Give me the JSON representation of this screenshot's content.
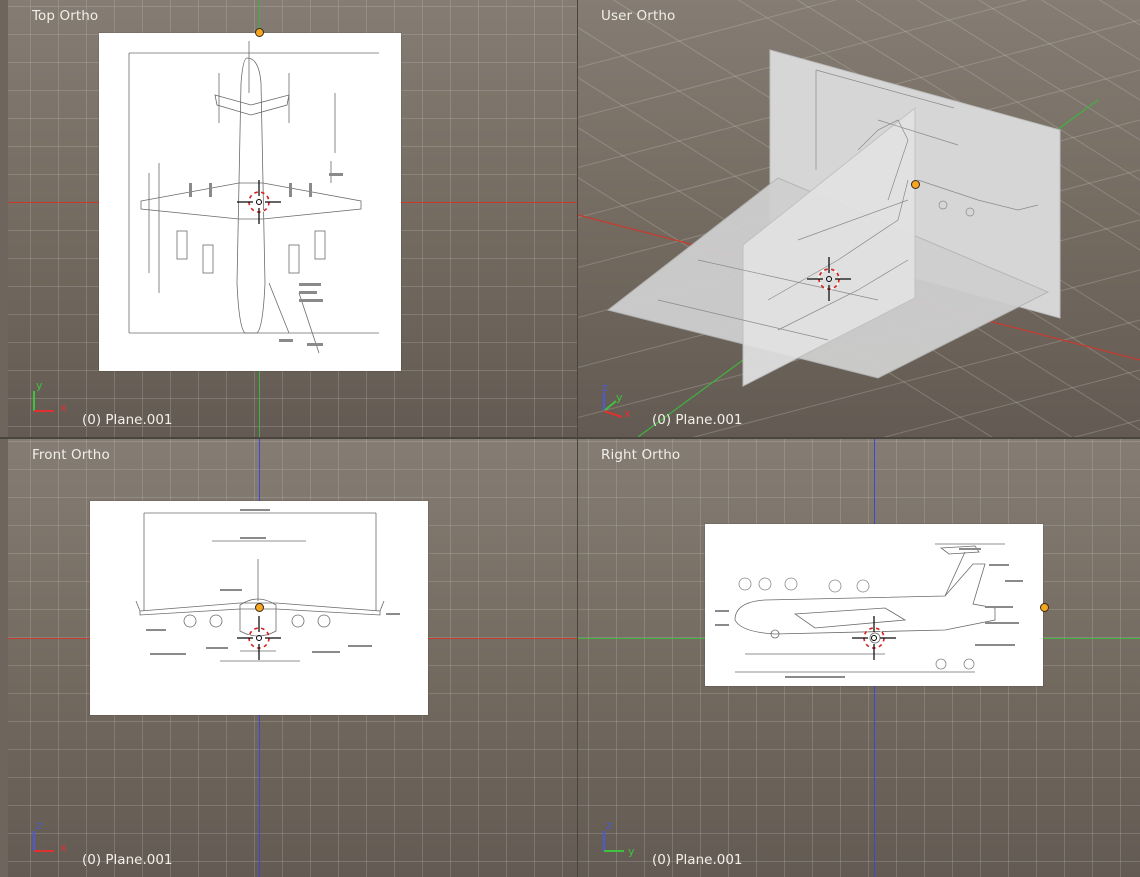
{
  "viewports": {
    "top": {
      "title": "Top Ortho",
      "object": "(0) Plane.001",
      "gizmo": [
        "y",
        "x"
      ]
    },
    "user": {
      "title": "User Ortho",
      "object": "(0) Plane.001",
      "gizmo": [
        "z",
        "y",
        "x"
      ]
    },
    "front": {
      "title": "Front Ortho",
      "object": "(0) Plane.001",
      "gizmo": [
        "z",
        "x"
      ]
    },
    "right": {
      "title": "Right Ortho",
      "object": "(0) Plane.001",
      "gizmo": [
        "z",
        "y"
      ]
    }
  },
  "colors": {
    "viewport_bg": "#72695f",
    "grid_line": "#b6b0a5",
    "axis_x": "#e03030",
    "axis_y": "#44c244",
    "axis_z": "#4a5ad8",
    "origin": "#f5a623",
    "cursor_ring": "#d42020"
  },
  "icons": [
    "3d-cursor-icon",
    "origin-dot-icon",
    "axis-gizmo-icon"
  ]
}
